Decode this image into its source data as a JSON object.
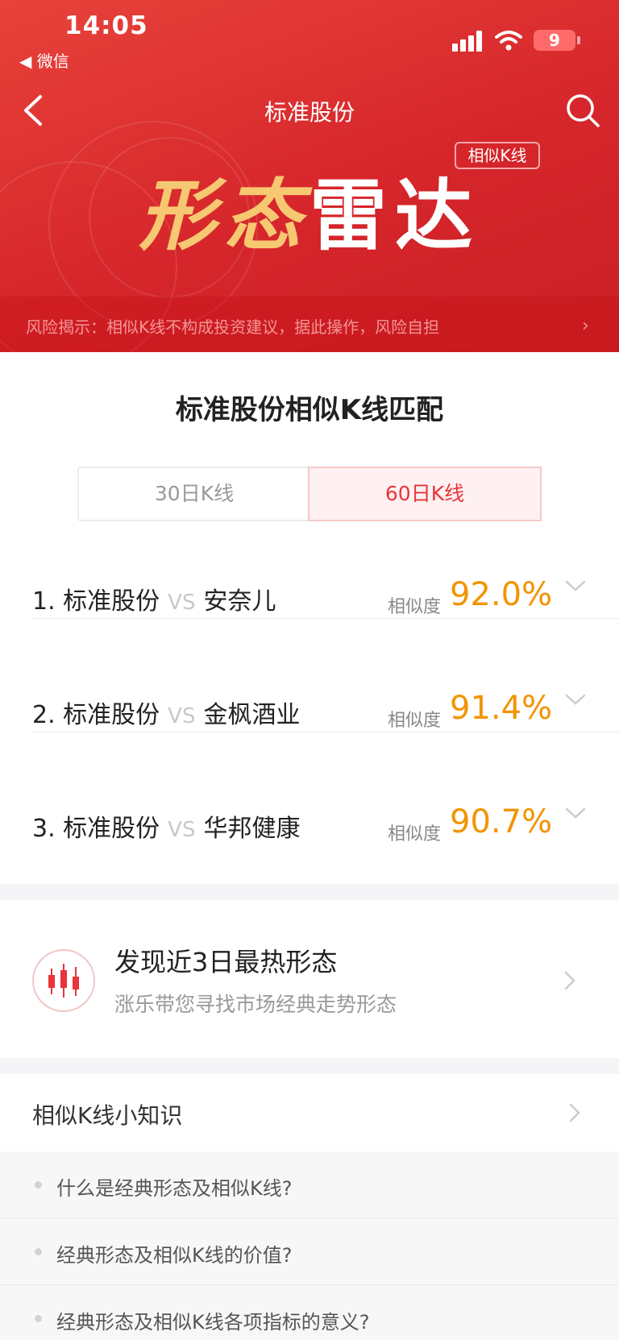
{
  "status_bar": {
    "time": "14:05",
    "back_app": "◀ 微信",
    "battery": "9"
  },
  "nav": {
    "title": "标准股份"
  },
  "banner": {
    "tag": "相似K线",
    "title_gold": "形态",
    "title_white": "雷达"
  },
  "risk": {
    "text": "风险揭示：相似K线不构成投资建议，据此操作，风险自担",
    "chevron": "›"
  },
  "match": {
    "title": "标准股份相似K线匹配",
    "tabs": [
      {
        "label": "30日K线",
        "active": false
      },
      {
        "label": "60日K线",
        "active": true
      }
    ],
    "sim_label": "相似度",
    "vs": "VS",
    "rows": [
      {
        "index": "1.",
        "stock": "标准股份",
        "peer": "安奈儿",
        "similarity": "92.0%"
      },
      {
        "index": "2.",
        "stock": "标准股份",
        "peer": "金枫酒业",
        "similarity": "91.4%"
      },
      {
        "index": "3.",
        "stock": "标准股份",
        "peer": "华邦健康",
        "similarity": "90.7%"
      }
    ]
  },
  "discover": {
    "title": "发现近3日最热形态",
    "subtitle": "涨乐带您寻找市场经典走势形态"
  },
  "knowledge": {
    "title": "相似K线小知识",
    "items": [
      "什么是经典形态及相似K线?",
      "经典形态及相似K线的价值?",
      "经典形态及相似K线各项指标的意义?"
    ]
  },
  "colors": {
    "header_red": "#d6262b",
    "accent_orange": "#f29400",
    "tab_active_red": "#e8343a",
    "title_gold": "#f7c872"
  }
}
